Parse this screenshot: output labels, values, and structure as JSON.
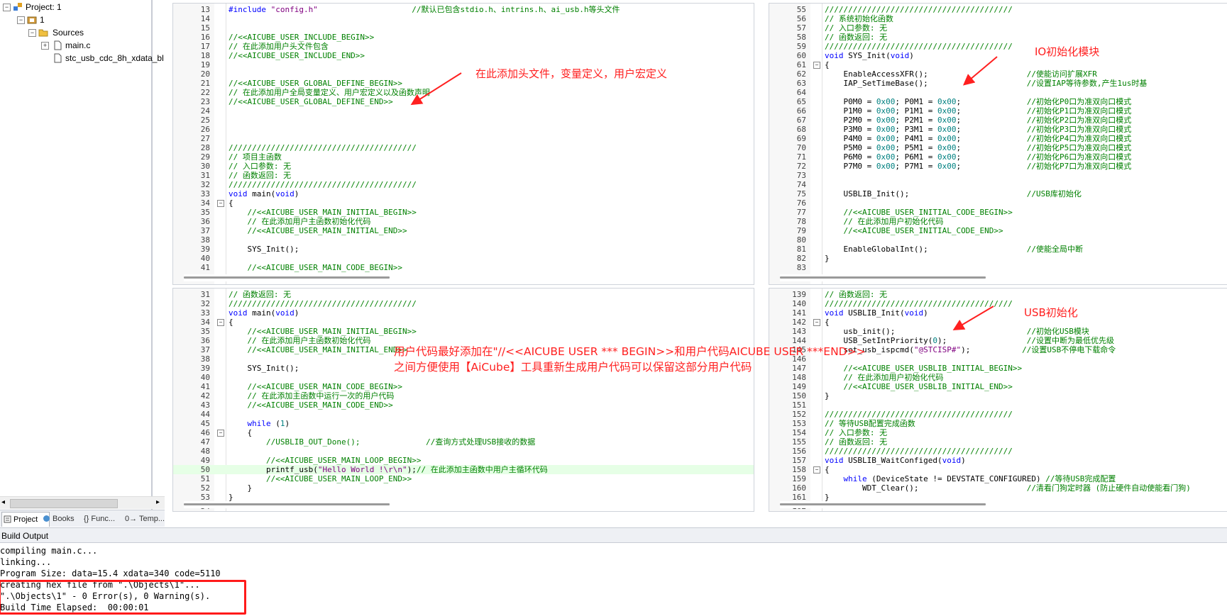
{
  "project_tree": {
    "project": "Project: 1",
    "target": "1",
    "group": "Sources",
    "files": [
      "main.c",
      "stc_usb_cdc_8h_xdata_bl"
    ]
  },
  "left_tabs": [
    "Project",
    "Books",
    "{} Func...",
    "0→ Temp..."
  ],
  "panes": [
    {
      "lines": [
        {
          "n": "13",
          "t": "#include \"config.h\"                    //默认已包含stdio.h、intrins.h、ai_usb.h等头文件"
        },
        {
          "n": "14",
          "t": ""
        },
        {
          "n": "15",
          "t": ""
        },
        {
          "n": "16",
          "t": "//<<AICUBE_USER_INCLUDE_BEGIN>>"
        },
        {
          "n": "17",
          "t": "// 在此添加用户头文件包含"
        },
        {
          "n": "18",
          "t": "//<<AICUBE_USER_INCLUDE_END>>"
        },
        {
          "n": "19",
          "t": ""
        },
        {
          "n": "20",
          "t": ""
        },
        {
          "n": "21",
          "t": "//<<AICUBE_USER_GLOBAL_DEFINE_BEGIN>>"
        },
        {
          "n": "22",
          "t": "// 在此添加用户全局变量定义、用户宏定义以及函数声明"
        },
        {
          "n": "23",
          "t": "//<<AICUBE_USER_GLOBAL_DEFINE_END>>"
        },
        {
          "n": "24",
          "t": ""
        },
        {
          "n": "25",
          "t": ""
        },
        {
          "n": "26",
          "t": ""
        },
        {
          "n": "27",
          "t": ""
        },
        {
          "n": "28",
          "t": "////////////////////////////////////////"
        },
        {
          "n": "29",
          "t": "// 项目主函数"
        },
        {
          "n": "30",
          "t": "// 入口参数: 无"
        },
        {
          "n": "31",
          "t": "// 函数返回: 无"
        },
        {
          "n": "32",
          "t": "////////////////////////////////////////"
        },
        {
          "n": "33",
          "t": "void main(void)"
        },
        {
          "n": "34",
          "t": "{"
        },
        {
          "n": "35",
          "t": "    //<<AICUBE_USER_MAIN_INITIAL_BEGIN>>"
        },
        {
          "n": "36",
          "t": "    // 在此添加用户主函数初始化代码"
        },
        {
          "n": "37",
          "t": "    //<<AICUBE_USER_MAIN_INITIAL_END>>"
        },
        {
          "n": "38",
          "t": ""
        },
        {
          "n": "39",
          "t": "    SYS_Init();"
        },
        {
          "n": "40",
          "t": ""
        },
        {
          "n": "41",
          "t": "    //<<AICUBE_USER_MAIN_CODE_BEGIN>>"
        }
      ]
    },
    {
      "lines": [
        {
          "n": "55",
          "t": "////////////////////////////////////////"
        },
        {
          "n": "56",
          "t": "// 系统初始化函数"
        },
        {
          "n": "57",
          "t": "// 入口参数: 无"
        },
        {
          "n": "58",
          "t": "// 函数返回: 无"
        },
        {
          "n": "59",
          "t": "////////////////////////////////////////"
        },
        {
          "n": "60",
          "t": "void SYS_Init(void)"
        },
        {
          "n": "61",
          "t": "{"
        },
        {
          "n": "62",
          "t": "    EnableAccessXFR();                     //使能访问扩展XFR"
        },
        {
          "n": "63",
          "t": "    IAP_SetTimeBase();                     //设置IAP等待参数,产生1us时基"
        },
        {
          "n": "64",
          "t": ""
        },
        {
          "n": "65",
          "t": "    P0M0 = 0x00; P0M1 = 0x00;              //初始化P0口为准双向口模式"
        },
        {
          "n": "66",
          "t": "    P1M0 = 0x00; P1M1 = 0x00;              //初始化P1口为准双向口模式"
        },
        {
          "n": "67",
          "t": "    P2M0 = 0x00; P2M1 = 0x00;              //初始化P2口为准双向口模式"
        },
        {
          "n": "68",
          "t": "    P3M0 = 0x00; P3M1 = 0x00;              //初始化P3口为准双向口模式"
        },
        {
          "n": "69",
          "t": "    P4M0 = 0x00; P4M1 = 0x00;              //初始化P4口为准双向口模式"
        },
        {
          "n": "70",
          "t": "    P5M0 = 0x00; P5M1 = 0x00;              //初始化P5口为准双向口模式"
        },
        {
          "n": "71",
          "t": "    P6M0 = 0x00; P6M1 = 0x00;              //初始化P6口为准双向口模式"
        },
        {
          "n": "72",
          "t": "    P7M0 = 0x00; P7M1 = 0x00;              //初始化P7口为准双向口模式"
        },
        {
          "n": "73",
          "t": ""
        },
        {
          "n": "74",
          "t": ""
        },
        {
          "n": "75",
          "t": "    USBLIB_Init();                         //USB库初始化"
        },
        {
          "n": "76",
          "t": ""
        },
        {
          "n": "77",
          "t": "    //<<AICUBE_USER_INITIAL_CODE_BEGIN>>"
        },
        {
          "n": "78",
          "t": "    // 在此添加用户初始化代码"
        },
        {
          "n": "79",
          "t": "    //<<AICUBE_USER_INITIAL_CODE_END>>"
        },
        {
          "n": "80",
          "t": ""
        },
        {
          "n": "81",
          "t": "    EnableGlobalInt();                     //使能全局中断"
        },
        {
          "n": "82",
          "t": "}"
        },
        {
          "n": "83",
          "t": ""
        }
      ]
    },
    {
      "lines": [
        {
          "n": "31",
          "t": "// 函数返回: 无"
        },
        {
          "n": "32",
          "t": "////////////////////////////////////////"
        },
        {
          "n": "33",
          "t": "void main(void)"
        },
        {
          "n": "34",
          "t": "{"
        },
        {
          "n": "35",
          "t": "    //<<AICUBE_USER_MAIN_INITIAL_BEGIN>>"
        },
        {
          "n": "36",
          "t": "    // 在此添加用户主函数初始化代码"
        },
        {
          "n": "37",
          "t": "    //<<AICUBE_USER_MAIN_INITIAL_END>>"
        },
        {
          "n": "38",
          "t": ""
        },
        {
          "n": "39",
          "t": "    SYS_Init();"
        },
        {
          "n": "40",
          "t": ""
        },
        {
          "n": "41",
          "t": "    //<<AICUBE_USER_MAIN_CODE_BEGIN>>"
        },
        {
          "n": "42",
          "t": "    // 在此添加主函数中运行一次的用户代码"
        },
        {
          "n": "43",
          "t": "    //<<AICUBE_USER_MAIN_CODE_END>>"
        },
        {
          "n": "44",
          "t": ""
        },
        {
          "n": "45",
          "t": "    while (1)"
        },
        {
          "n": "46",
          "t": "    {"
        },
        {
          "n": "47",
          "t": "        //USBLIB_OUT_Done();              //查询方式处理USB接收的数据"
        },
        {
          "n": "48",
          "t": ""
        },
        {
          "n": "49",
          "t": "        //<<AICUBE_USER_MAIN_LOOP_BEGIN>>"
        },
        {
          "n": "50",
          "t": "        printf_usb(\"Hello World !\\r\\n\");// 在此添加主函数中用户主循环代码"
        },
        {
          "n": "51",
          "t": "        //<<AICUBE_USER_MAIN_LOOP_END>>"
        },
        {
          "n": "52",
          "t": "    }"
        },
        {
          "n": "53",
          "t": "}"
        },
        {
          "n": "54",
          "t": ""
        }
      ]
    },
    {
      "lines": [
        {
          "n": "139",
          "t": "// 函数返回: 无"
        },
        {
          "n": "140",
          "t": "////////////////////////////////////////"
        },
        {
          "n": "141",
          "t": "void USBLIB_Init(void)"
        },
        {
          "n": "142",
          "t": "{"
        },
        {
          "n": "143",
          "t": "    usb_init();                            //初始化USB模块"
        },
        {
          "n": "144",
          "t": "    USB_SetIntPriority(0);                 //设置中断为最低优先级"
        },
        {
          "n": "145",
          "t": "    set_usb_ispcmd(\"@STCISP#\");           //设置USB不停电下载命令"
        },
        {
          "n": "146",
          "t": ""
        },
        {
          "n": "147",
          "t": "    //<<AICUBE_USER_USBLIB_INITIAL_BEGIN>>"
        },
        {
          "n": "148",
          "t": "    // 在此添加用户初始化代码"
        },
        {
          "n": "149",
          "t": "    //<<AICUBE_USER_USBLIB_INITIAL_END>>"
        },
        {
          "n": "150",
          "t": "}"
        },
        {
          "n": "151",
          "t": ""
        },
        {
          "n": "152",
          "t": "////////////////////////////////////////"
        },
        {
          "n": "153",
          "t": "// 等待USB配置完成函数"
        },
        {
          "n": "154",
          "t": "// 入口参数: 无"
        },
        {
          "n": "155",
          "t": "// 函数返回: 无"
        },
        {
          "n": "156",
          "t": "////////////////////////////////////////"
        },
        {
          "n": "157",
          "t": "void USBLIB_WaitConfiged(void)"
        },
        {
          "n": "158",
          "t": "{"
        },
        {
          "n": "159",
          "t": "    while (DeviceState != DEVSTATE_CONFIGURED) //等待USB完成配置"
        },
        {
          "n": "160",
          "t": "        WDT_Clear();                       //清看门狗定时器 (防止硬件自动使能看门狗)"
        },
        {
          "n": "161",
          "t": "}"
        },
        {
          "n": "162",
          "t": ""
        }
      ]
    }
  ],
  "annotations": {
    "header_note": "在此添加头文件，变量定义，用户宏定义",
    "io_note": "IO初始化模块",
    "usb_note": "USB初始化",
    "user_code_note_1": "用户代码最好添加在\"//<<AICUBE USER *** BEGIN>>和用户代码AICUBE USER ***END>>",
    "user_code_note_2": "之间方便使用【AiCube】工具重新生成用户代码可以保留这部分用户代码"
  },
  "build_output": {
    "title": "Build Output",
    "lines": [
      "compiling main.c...",
      "linking...",
      "Program Size: data=15.4 xdata=340 code=5110",
      "creating hex file from \".\\Objects\\1\"...",
      "\".\\Objects\\1\" - 0 Error(s), 0 Warning(s).",
      "Build Time Elapsed:  00:00:01"
    ]
  },
  "colors": {
    "comment": "#008000",
    "keyword": "#0000ff",
    "annotation": "#ff2020",
    "highlight_line": "#e6ffe6"
  }
}
